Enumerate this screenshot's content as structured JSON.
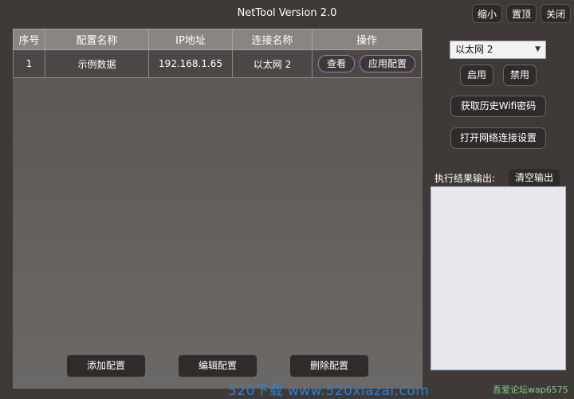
{
  "window": {
    "title": "NetTool Version 2.0",
    "buttons": {
      "minimize": "缩小",
      "pin": "置顶",
      "close": "关闭"
    }
  },
  "table": {
    "headers": [
      "序号",
      "配置名称",
      "IP地址",
      "连接名称",
      "操作"
    ],
    "rows": [
      {
        "index": "1",
        "name": "示例数据",
        "ip": "192.168.1.65",
        "connection": "以太网 2",
        "view_label": "查看",
        "apply_label": "应用配置"
      }
    ]
  },
  "bottom_actions": {
    "add": "添加配置",
    "edit": "编辑配置",
    "delete": "删除配置"
  },
  "sidebar": {
    "adapter_select": {
      "value": "以太网 2"
    },
    "enable": "启用",
    "disable": "禁用",
    "get_wifi": "获取历史Wifi密码",
    "open_network": "打开网络连接设置",
    "output_label": "执行结果输出:",
    "clear_output": "清空输出",
    "output_text": ""
  },
  "watermarks": {
    "site": "520下载 www.520xiazai.com",
    "forum": "吾爱论坛wap6575"
  },
  "colors": {
    "background": "#3f3a38",
    "accent_border": "#9a7fb4",
    "watermark_blue": "#2e7fd6"
  }
}
